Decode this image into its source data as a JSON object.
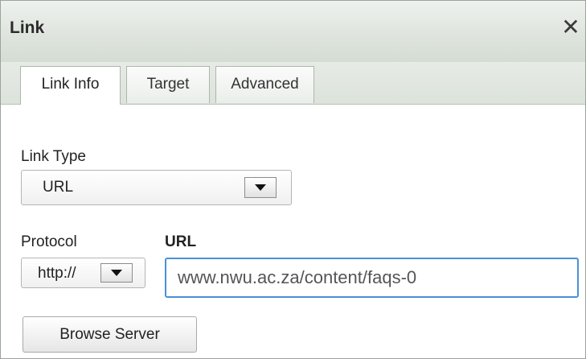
{
  "dialog": {
    "title": "Link",
    "close_icon": "close-icon",
    "close_glyph": "✕"
  },
  "tabs": [
    {
      "label": "Link Info",
      "active": true
    },
    {
      "label": "Target",
      "active": false
    },
    {
      "label": "Advanced",
      "active": false
    }
  ],
  "link_type": {
    "label": "Link Type",
    "value": "URL",
    "icon": "dropdown-arrow-icon"
  },
  "protocol": {
    "label": "Protocol",
    "value": "http://",
    "icon": "dropdown-arrow-icon"
  },
  "url": {
    "label": "URL",
    "value": "www.nwu.ac.za/content/faqs-0"
  },
  "browse_button": {
    "label": "Browse Server"
  },
  "colors": {
    "title_bar": "#dfe5de",
    "focus_border": "#4a90d9"
  }
}
